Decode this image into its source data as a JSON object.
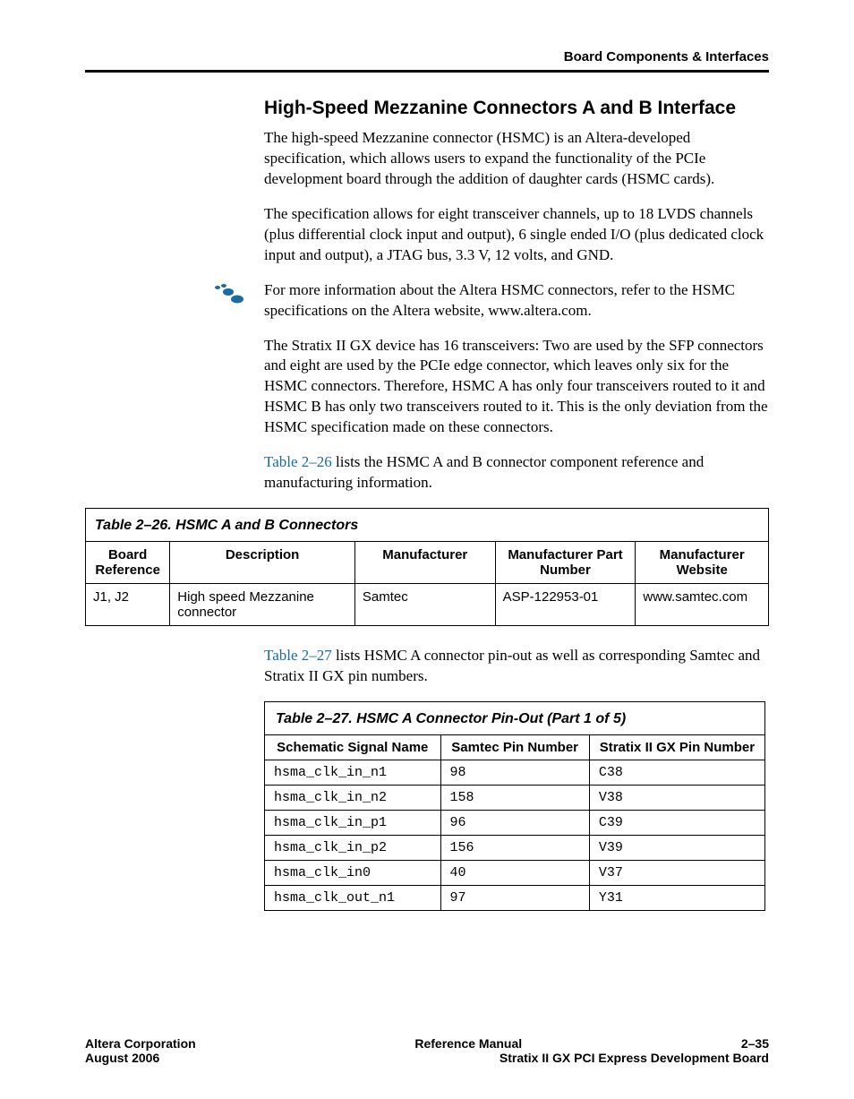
{
  "header": {
    "section": "Board Components & Interfaces"
  },
  "title": "High-Speed Mezzanine Connectors A and B Interface",
  "paras": {
    "p1": "The high-speed Mezzanine connector (HSMC) is an Altera-developed specification, which allows users to expand the functionality of the PCIe development board through the addition of daughter cards (HSMC cards).",
    "p2": "The specification allows for eight transceiver channels, up to 18 LVDS channels (plus differential clock input and output), 6 single ended I/O (plus dedicated clock input and output), a JTAG bus, 3.3 V, 12 volts, and GND.",
    "p3a": "For more information about the Altera HSMC connectors, refer to the HSMC specifications on the Altera website, ",
    "p3b": "www.altera.com",
    "p3c": ".",
    "p4": "The Stratix II GX device has 16 transceivers: Two are used by the SFP connectors and eight are used by the PCIe edge connector, which leaves only six for the HSMC connectors. Therefore, HSMC A has only four transceivers routed to it and HSMC B has only two transceivers routed to it. This is the only deviation from the HSMC specification made on these connectors.",
    "p5a": "Table 2–26",
    "p5b": " lists the HSMC A and B connector component reference and manufacturing information.",
    "p6a": "Table 2–27",
    "p6b": " lists HSMC A connector pin-out as well as corresponding Samtec and Stratix II GX pin numbers."
  },
  "table26": {
    "caption": "Table 2–26. HSMC A and B Connectors",
    "headers": {
      "board": "Board Reference",
      "desc": "Description",
      "mfr": "Manufacturer",
      "part": "Manufacturer Part Number",
      "web": "Manufacturer Website"
    },
    "rows": [
      {
        "board": "J1, J2",
        "desc": "High speed Mezzanine connector",
        "mfr": "Samtec",
        "part": "ASP-122953-01",
        "web": "www.samtec.com"
      }
    ]
  },
  "table27": {
    "caption": "Table 2–27. HSMC A Connector Pin-Out   (Part 1 of 5)",
    "headers": {
      "sig": "Schematic Signal Name",
      "sam": "Samtec Pin Number",
      "gx": "Stratix II GX Pin Number"
    },
    "rows": [
      {
        "sig": "hsma_clk_in_n1",
        "sam": "98",
        "gx": "C38"
      },
      {
        "sig": "hsma_clk_in_n2",
        "sam": "158",
        "gx": "V38"
      },
      {
        "sig": "hsma_clk_in_p1",
        "sam": "96",
        "gx": "C39"
      },
      {
        "sig": "hsma_clk_in_p2",
        "sam": "156",
        "gx": "V39"
      },
      {
        "sig": "hsma_clk_in0",
        "sam": "40",
        "gx": "V37"
      },
      {
        "sig": "hsma_clk_out_n1",
        "sam": "97",
        "gx": "Y31"
      }
    ]
  },
  "footer": {
    "l1_left": "Altera Corporation",
    "l1_center": "Reference Manual",
    "l1_right": "2–35",
    "l2_left": "August 2006",
    "l2_right": "Stratix II GX PCI Express Development Board"
  }
}
